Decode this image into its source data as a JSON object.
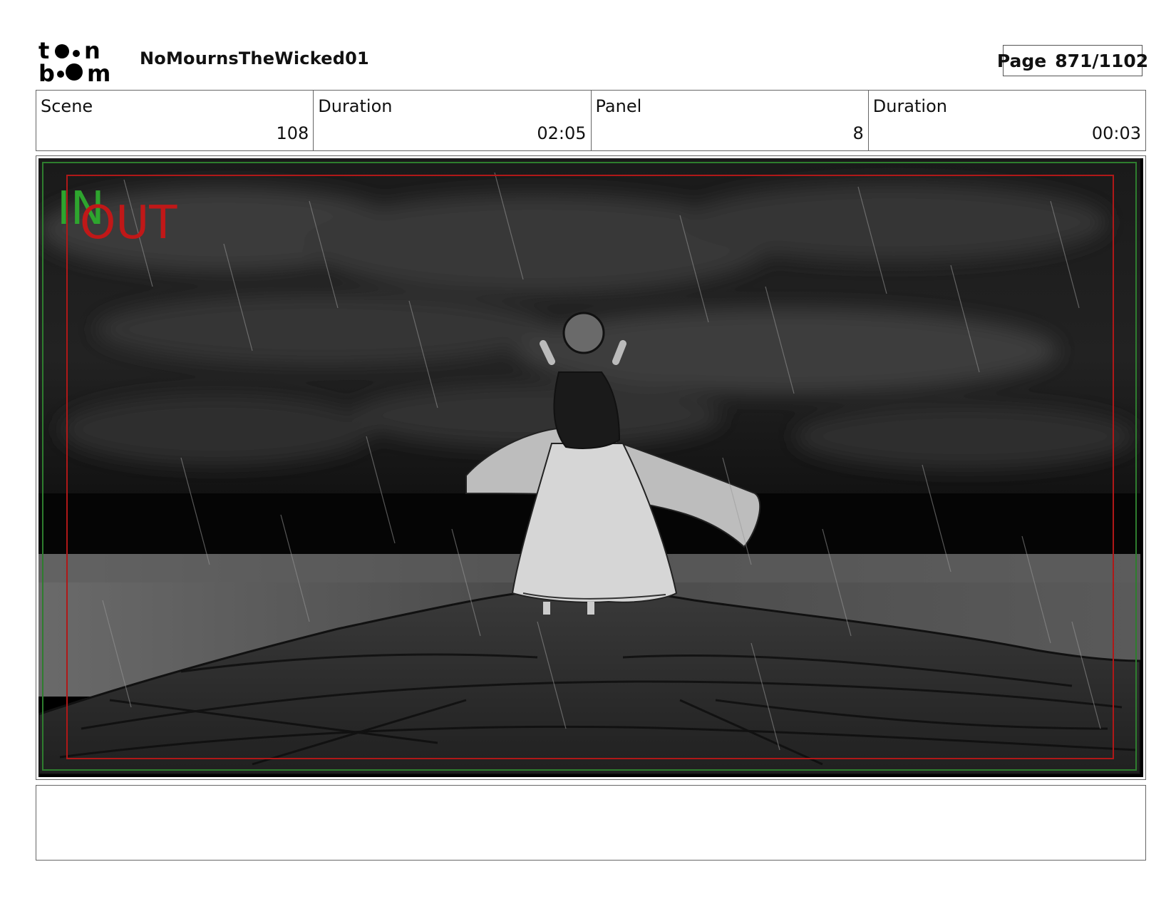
{
  "header": {
    "project_title": "NoMournsTheWicked01",
    "page_label": "Page",
    "page_number": "871/1102"
  },
  "info": {
    "scene_label": "Scene",
    "scene_value": "108",
    "scene_duration_label": "Duration",
    "scene_duration_value": "02:05",
    "panel_label": "Panel",
    "panel_value": "8",
    "panel_duration_label": "Duration",
    "panel_duration_value": "00:03"
  },
  "frame": {
    "in_label": "IN",
    "out_label": "OUT",
    "in_color": "#2ea52e",
    "out_color": "#c01818"
  },
  "notes": {
    "text": ""
  }
}
